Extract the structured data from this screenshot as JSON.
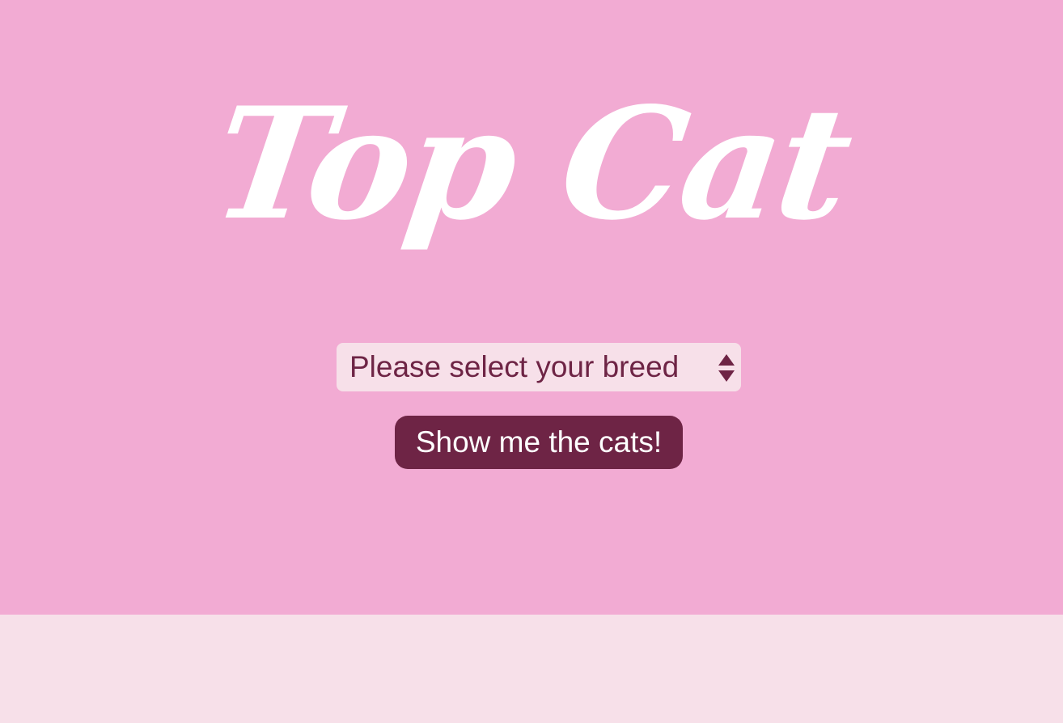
{
  "header": {
    "logo_text": "Top Cat"
  },
  "breed_select": {
    "selected_value": "Please select your breed",
    "options": [
      "Please select your breed"
    ]
  },
  "actions": {
    "show_button_label": "Show me the cats!"
  },
  "colors": {
    "hero_background": "#f2abd3",
    "footer_background": "#f7e0e9",
    "select_background": "#f7e0e9",
    "accent": "#6e2445",
    "logo": "#ffffff"
  },
  "icons": {
    "select_arrows": "up-down-arrows-icon"
  }
}
